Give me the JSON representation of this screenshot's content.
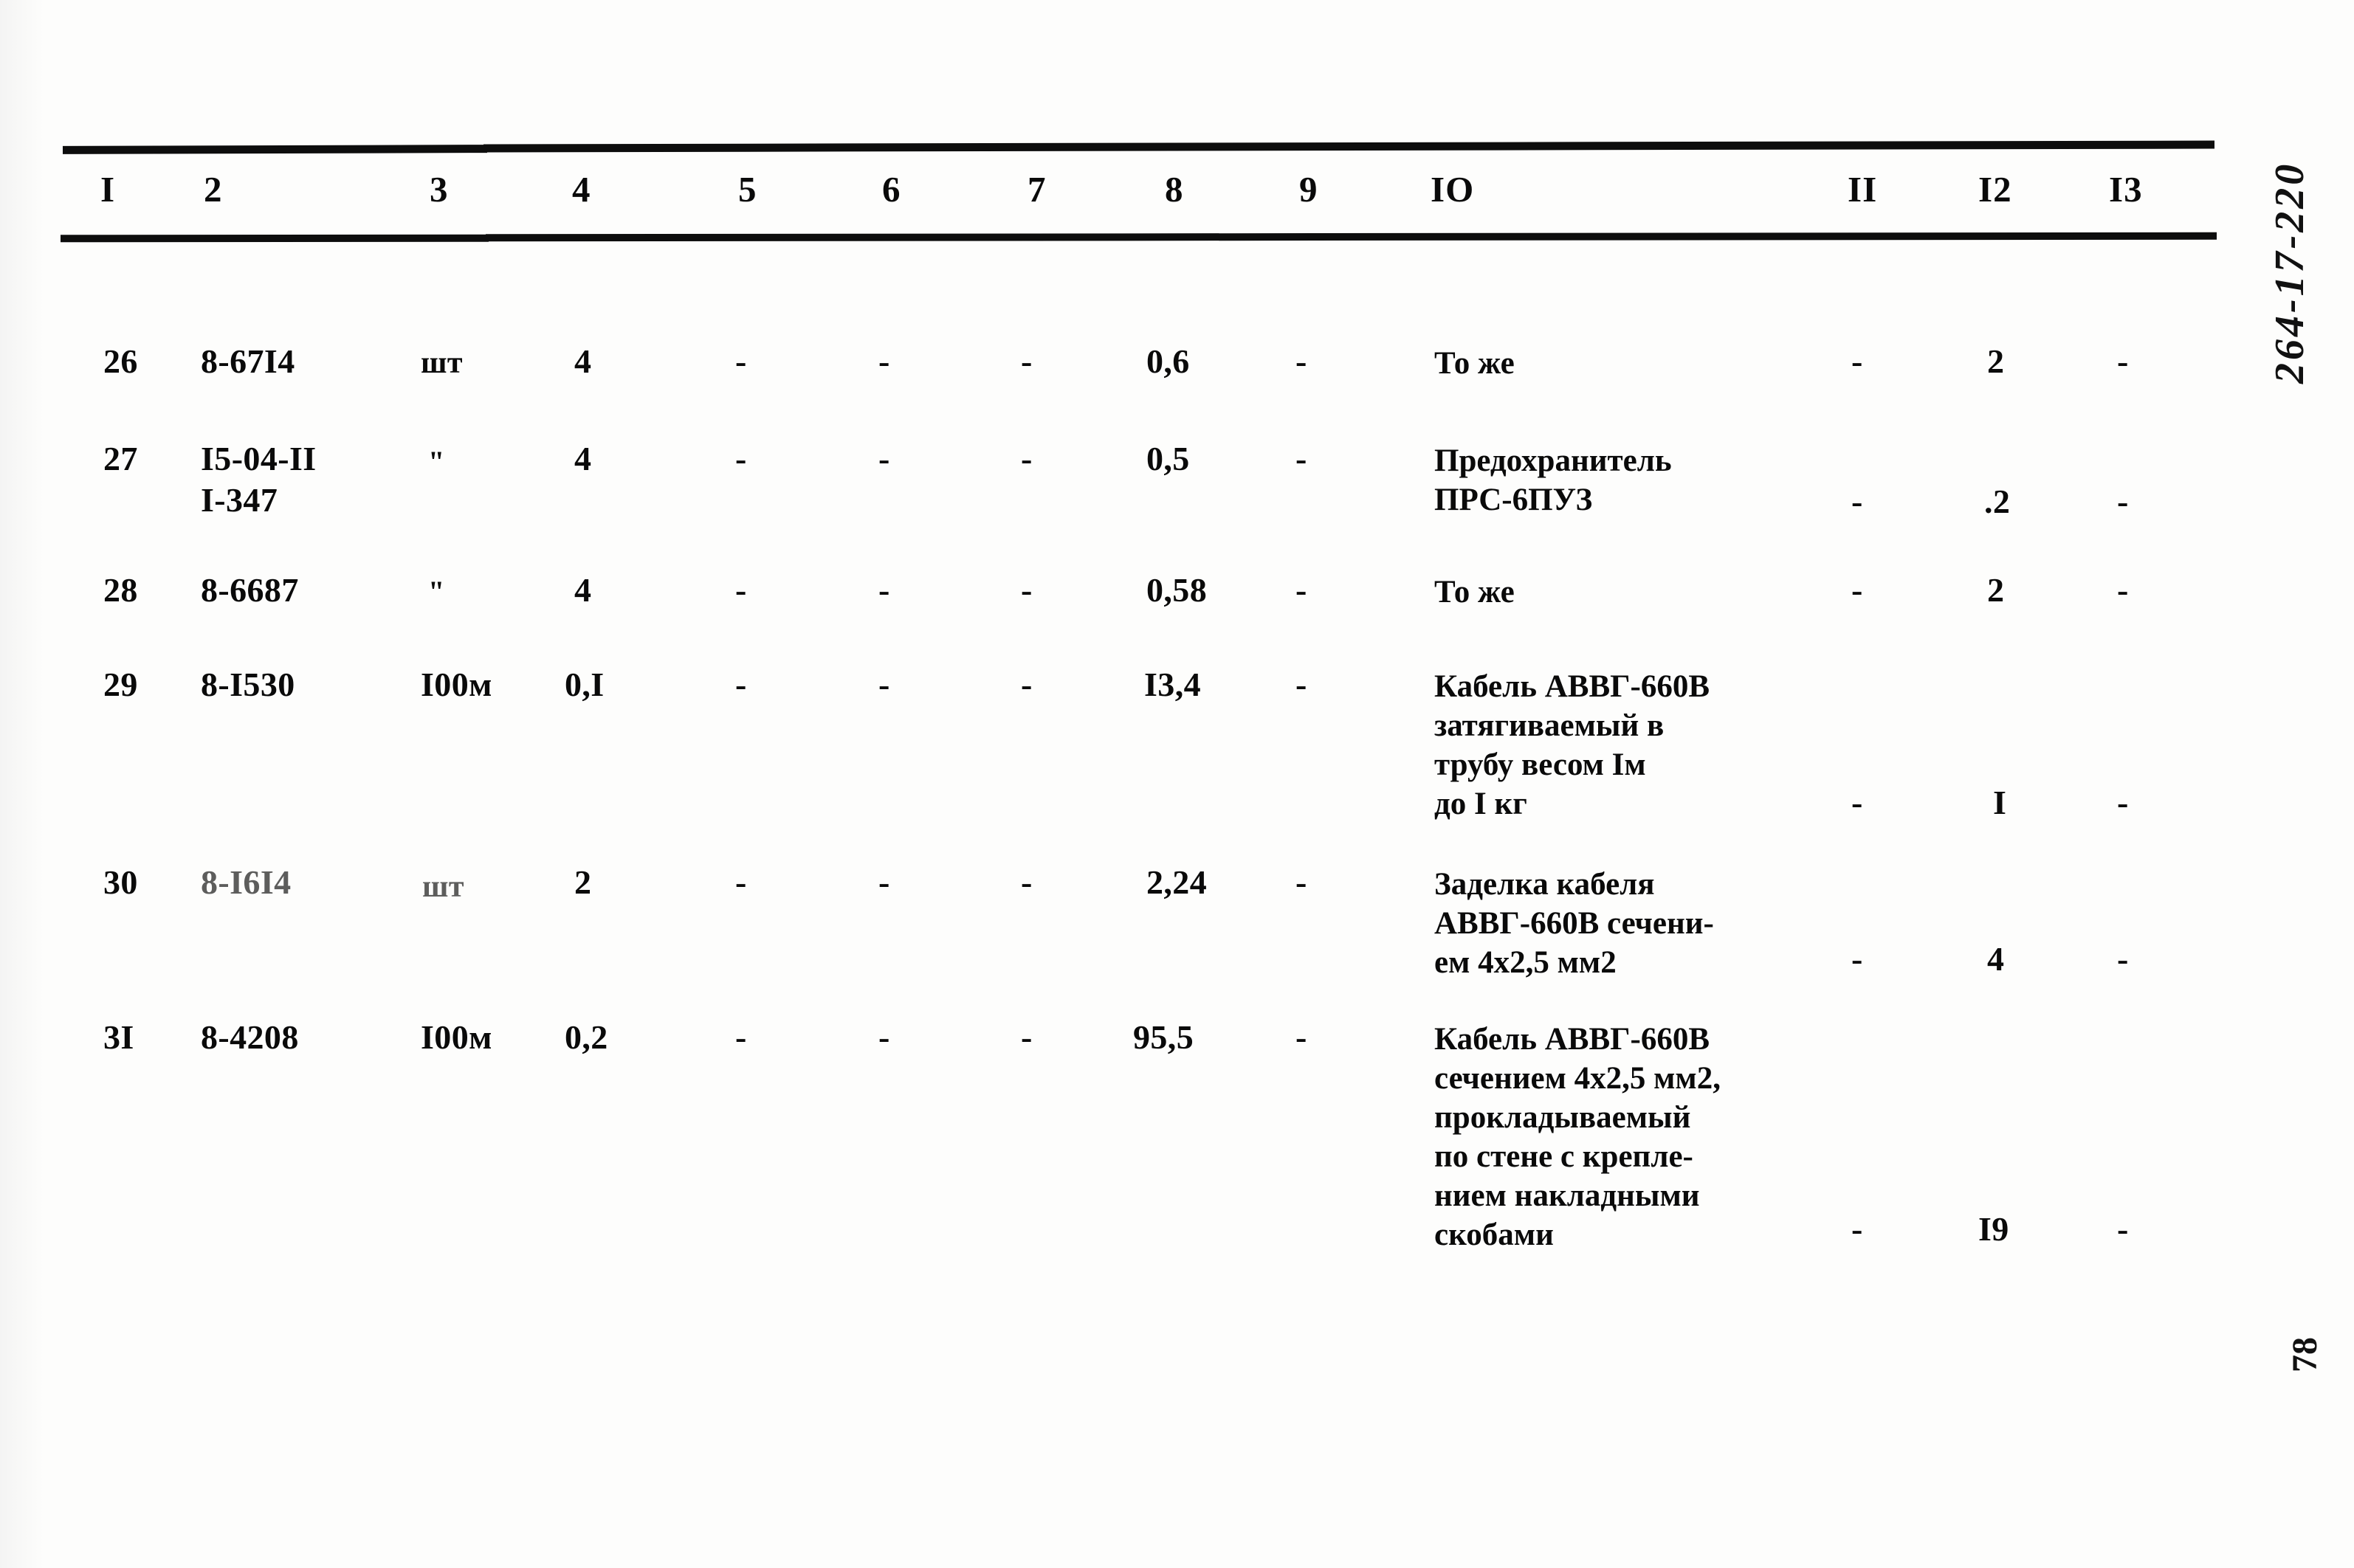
{
  "document": {
    "margin_note": "264-17-220",
    "page_number": "78"
  },
  "table": {
    "headers": [
      "I",
      "2",
      "3",
      "4",
      "5",
      "6",
      "7",
      "8",
      "9",
      "IO",
      "II",
      "I2",
      "I3"
    ],
    "rows": [
      {
        "c1": "26",
        "c2": "8-67I4",
        "c3": "шт",
        "c4": "4",
        "c5": "-",
        "c6": "-",
        "c7": "-",
        "c8": "0,6",
        "c9": "-",
        "c10": "То же",
        "c11": "-",
        "c12": "2",
        "c13": "-"
      },
      {
        "c1": "27",
        "c2": "I5-04-II\nI-347",
        "c3": "\"",
        "c4": "4",
        "c5": "-",
        "c6": "-",
        "c7": "-",
        "c8": "0,5",
        "c9": "-",
        "c10": "Предохранитель\nПРС-6ПУЗ",
        "c11": "-",
        "c12": ".2",
        "c13": "-"
      },
      {
        "c1": "28",
        "c2": "8-6687",
        "c3": "\"",
        "c4": "4",
        "c5": "-",
        "c6": "-",
        "c7": "-",
        "c8": "0,58",
        "c9": "-",
        "c10": "То же",
        "c11": "-",
        "c12": "2",
        "c13": "-"
      },
      {
        "c1": "29",
        "c2": "8-I530",
        "c3": "I00м",
        "c4": "0,I",
        "c5": "-",
        "c6": "-",
        "c7": "-",
        "c8": "I3,4",
        "c9": "-",
        "c10": "Кабель АВВГ-660В\nзатягиваемый в\nтрубу весом Iм\nдо I кг",
        "c11": "-",
        "c12": "I",
        "c13": "-"
      },
      {
        "c1": "30",
        "c2": "8-I6I4",
        "c3": "шт",
        "c4": "2",
        "c5": "-",
        "c6": "-",
        "c7": "-",
        "c8": "2,24",
        "c9": "-",
        "c10": "Заделка кабеля\nАВВГ-660В сечени-\nем 4х2,5 мм2",
        "c11": "-",
        "c12": "4",
        "c13": "-"
      },
      {
        "c1": "3I",
        "c2": "8-4208",
        "c3": "I00м",
        "c4": "0,2",
        "c5": "-",
        "c6": "-",
        "c7": "-",
        "c8": "95,5",
        "c9": "-",
        "c10": "Кабель АВВГ-660В\nсечением 4х2,5 мм2,\nпрокладываемый\nпо стене с крепле-\nнием накладными\nскобами",
        "c11": "-",
        "c12": "I9",
        "c13": "-"
      }
    ]
  }
}
